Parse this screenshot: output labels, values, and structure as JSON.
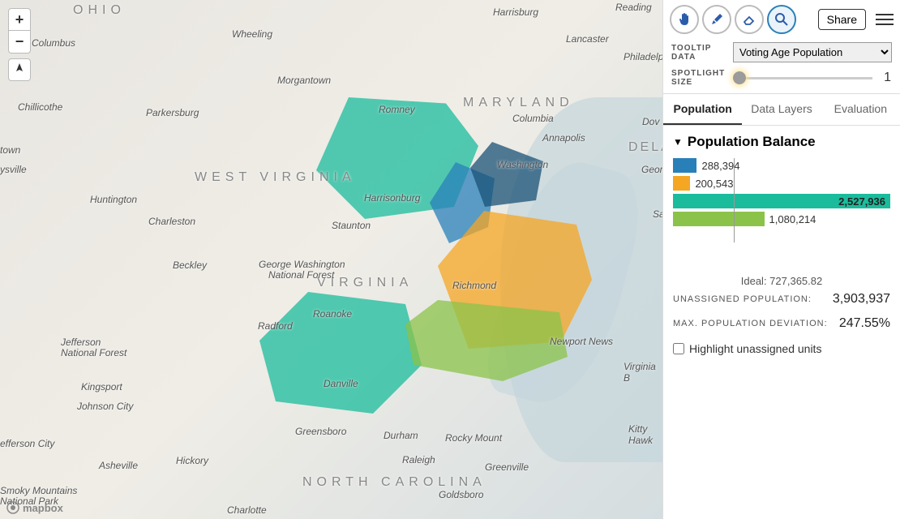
{
  "map": {
    "states": {
      "ohio": "OHIO",
      "west_virginia": "WEST VIRGINIA",
      "virginia": "VIRGINIA",
      "maryland": "MARYLAND",
      "north_carolina": "NORTH CAROLINA",
      "delaware": "DELAW"
    },
    "cities": {
      "columbus": "Columbus",
      "wheeling": "Wheeling",
      "harrisburg": "Harrisburg",
      "reading": "Reading",
      "lancaster": "Lancaster",
      "philadelphia": "Philadelp",
      "chillicothe": "Chillicothe",
      "parkersburg": "Parkersburg",
      "morgantown": "Morgantown",
      "romney": "Romney",
      "columbia": "Columbia",
      "annapolis": "Annapolis",
      "dover": "Dov",
      "huntington": "Huntington",
      "charleston": "Charleston",
      "harrisonburg": "Harrisonburg",
      "washington": "Washington",
      "georg": "Georg",
      "sa": "Sa",
      "staunton": "Staunton",
      "beckley": "Beckley",
      "gwf": "George Washington",
      "nf": "National Forest",
      "richmond": "Richmond",
      "roanoke": "Roanoke",
      "radford": "Radford",
      "jefferson": "Jefferson",
      "natfor": "National Forest",
      "kingsport": "Kingsport",
      "danville": "Danville",
      "newport": "Newport News",
      "vab": "Virginia B",
      "johnson": "Johnson City",
      "greensboro": "Greensboro",
      "durham": "Durham",
      "rocky": "Rocky Mount",
      "kitty": "Kitty Hawk",
      "asheville": "Asheville",
      "hickory": "Hickory",
      "raleigh": "Raleigh",
      "greenville": "Greenville",
      "smoky1": "Smoky Mountains",
      "smoky2": "National Park",
      "charlotte": "Charlotte",
      "goldsboro": "Goldsboro",
      "jefcity": "efferson City",
      "ysville": "ysville",
      "town": "town"
    },
    "logo": "mapbox"
  },
  "toolbar": {
    "share": "Share"
  },
  "controls": {
    "tooltip_label": "TOOLTIP DATA",
    "tooltip_value": "Voting Age Population",
    "spotlight_label": "SPOTLIGHT SIZE",
    "spotlight_value": "1"
  },
  "tabs": {
    "population": "Population",
    "data_layers": "Data Layers",
    "evaluation": "Evaluation"
  },
  "panel": {
    "title": "Population Balance",
    "bars": [
      {
        "color": "#2980b9",
        "value": "288,394",
        "width": 11
      },
      {
        "color": "#f5a623",
        "value": "200,543",
        "width": 8
      },
      {
        "color": "#1abc9c",
        "value": "2,527,936",
        "width": 100,
        "over": true
      },
      {
        "color": "#8bc34a",
        "value": "1,080,214",
        "width": 42
      }
    ],
    "ideal_label": "Ideal: 727,365.82",
    "ideal_pct": 28,
    "stats": {
      "unassigned_label": "UNASSIGNED POPULATION:",
      "unassigned_value": "3,903,937",
      "deviation_label": "MAX. POPULATION DEVIATION:",
      "deviation_value": "247.55%"
    },
    "highlight_label": "Highlight unassigned units"
  }
}
